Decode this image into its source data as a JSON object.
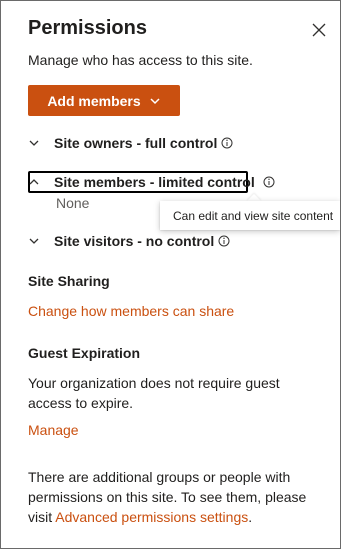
{
  "panel": {
    "title": "Permissions",
    "subtitle": "Manage who has access to this site.",
    "close_label": "Close"
  },
  "add_members": {
    "label": "Add members"
  },
  "groups": [
    {
      "label": "Site owners - full control",
      "expanded": false
    },
    {
      "label": "Site members - limited control",
      "expanded": true,
      "members_text": "None"
    },
    {
      "label": "Site visitors - no control",
      "expanded": false
    }
  ],
  "tooltip": {
    "text": "Can edit and view site content"
  },
  "site_sharing": {
    "heading": "Site Sharing",
    "link": "Change how members can share"
  },
  "guest_expiration": {
    "heading": "Guest Expiration",
    "description": "Your organization does not require guest access to expire.",
    "link": "Manage"
  },
  "footer": {
    "text": "There are additional groups or people with permissions on this site. To see them, please visit",
    "link": "Advanced permissions settings",
    "trailing": "."
  },
  "colors": {
    "accent": "#ca5010",
    "text": "#201f1e",
    "muted": "#605e5c"
  },
  "icons": {
    "close": "close-icon",
    "dropdown": "chevron-down-icon",
    "collapsed": "chevron-down-icon",
    "expanded": "chevron-up-icon",
    "info": "info-icon"
  }
}
